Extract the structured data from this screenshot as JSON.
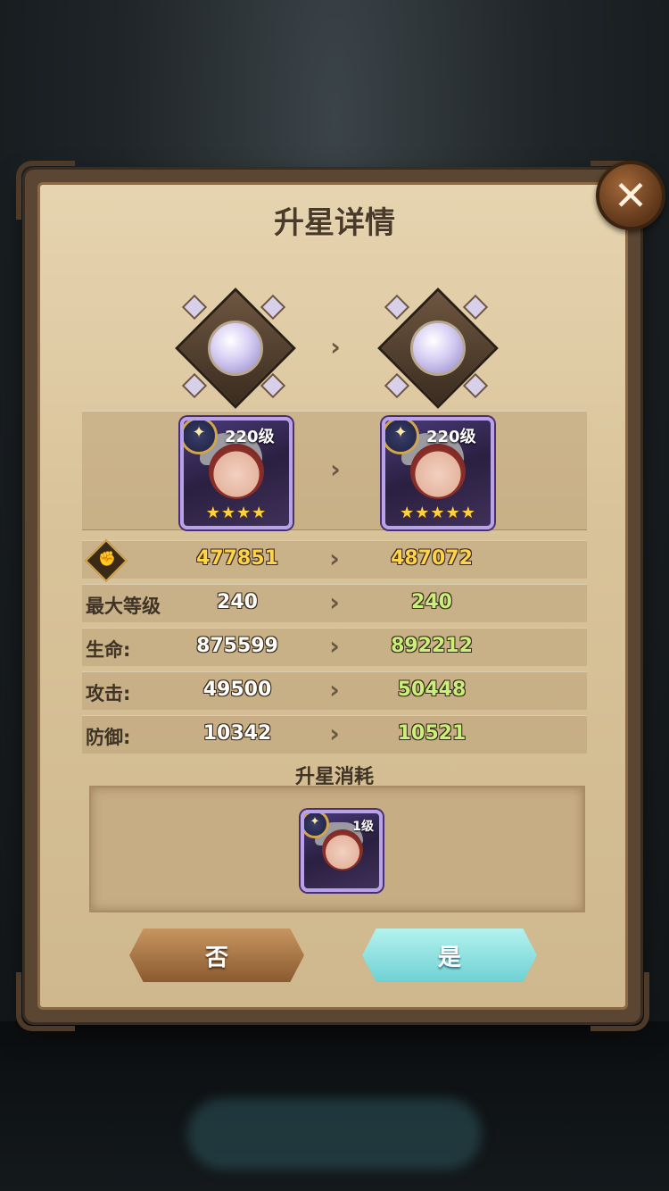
{
  "dialog": {
    "title": "升星详情",
    "close_icon": "close-icon"
  },
  "hero_before": {
    "level": "220级",
    "stars": "★★★★",
    "star_count": 4
  },
  "hero_after": {
    "level": "220级",
    "stars": "★★★★★",
    "star_count": 5
  },
  "stats": {
    "power": {
      "icon": "fist-icon",
      "old": "477851",
      "new": "487072"
    },
    "max_level": {
      "label": "最大等级",
      "old": "240",
      "new": "240"
    },
    "hp": {
      "label": "生命:",
      "old": "875599",
      "new": "892212"
    },
    "attack": {
      "label": "攻击:",
      "old": "49500",
      "new": "50448"
    },
    "defense": {
      "label": "防御:",
      "old": "10342",
      "new": "10521"
    }
  },
  "cost": {
    "title": "升星消耗",
    "item_level": "1级"
  },
  "buttons": {
    "no": "否",
    "yes": "是"
  },
  "colors": {
    "stat_new": "#c8f07a",
    "power_value": "#ffd34a",
    "yes_button": "#6fd1d4",
    "no_button": "#8a5a30"
  }
}
